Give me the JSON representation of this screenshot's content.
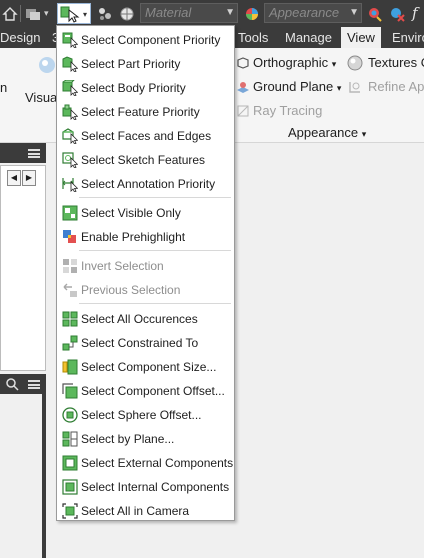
{
  "toolbar": {
    "material_placeholder": "Material",
    "appearance_placeholder": "Appearance",
    "fx_label": "f"
  },
  "tabs": [
    {
      "label": "Design"
    },
    {
      "label": "3"
    },
    {
      "label": "Tools"
    },
    {
      "label": "Manage"
    },
    {
      "label": "View"
    },
    {
      "label": "Enviro"
    }
  ],
  "ribbon": {
    "visual_label": "Visual",
    "left_label": "n",
    "orthographic": "Orthographic",
    "textures": "Textures O",
    "ground_plane": "Ground Plane",
    "refine": "Refine App",
    "ray_tracing": "Ray Tracing",
    "appearance_panel": "Appearance"
  },
  "menu": {
    "items": [
      {
        "label": "Select Component Priority",
        "icon": "component-priority-icon"
      },
      {
        "label": "Select Part Priority",
        "icon": "part-priority-icon"
      },
      {
        "label": "Select Body Priority",
        "icon": "body-priority-icon"
      },
      {
        "label": "Select Feature Priority",
        "icon": "feature-priority-icon"
      },
      {
        "label": "Select Faces and Edges",
        "icon": "faces-edges-icon"
      },
      {
        "label": "Select Sketch Features",
        "icon": "sketch-features-icon"
      },
      {
        "label": "Select Annotation Priority",
        "icon": "annotation-priority-icon"
      },
      {
        "label": "Select Visible Only",
        "icon": "visible-only-icon"
      },
      {
        "label": "Enable Prehighlight",
        "icon": "prehighlight-icon"
      },
      {
        "label": "Invert Selection",
        "icon": "invert-selection-icon",
        "disabled": true
      },
      {
        "label": "Previous Selection",
        "icon": "previous-selection-icon",
        "disabled": true
      },
      {
        "label": "Select All Occurences",
        "icon": "all-occurences-icon"
      },
      {
        "label": "Select Constrained To",
        "icon": "constrained-to-icon"
      },
      {
        "label": "Select Component Size...",
        "icon": "component-size-icon"
      },
      {
        "label": "Select Component Offset...",
        "icon": "component-offset-icon"
      },
      {
        "label": "Select Sphere Offset...",
        "icon": "sphere-offset-icon"
      },
      {
        "label": "Select by Plane...",
        "icon": "by-plane-icon"
      },
      {
        "label": "Select External Components",
        "icon": "external-components-icon"
      },
      {
        "label": "Select Internal Components",
        "icon": "internal-components-icon"
      },
      {
        "label": "Select All in Camera",
        "icon": "all-in-camera-icon"
      }
    ]
  },
  "colors": {
    "dark_bar": "#3b3b3b",
    "icon_green": "#5cb85c",
    "icon_green_dark": "#2e7d32",
    "menu_bg": "#ffffff"
  }
}
